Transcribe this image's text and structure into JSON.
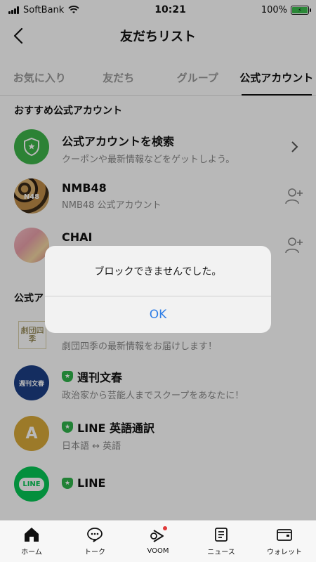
{
  "status": {
    "carrier": "SoftBank",
    "time": "10:21",
    "battery": "100%"
  },
  "nav": {
    "title": "友だちリスト"
  },
  "tabs": [
    {
      "label": "お気に入り"
    },
    {
      "label": "友だち"
    },
    {
      "label": "グループ"
    },
    {
      "label": "公式アカウント"
    }
  ],
  "sections": {
    "recommended": "おすすめ公式アカウント",
    "official": "公式ア"
  },
  "rows": [
    {
      "name": "公式アカウントを検索",
      "sub": "クーポンや最新情報などをゲットしよう。"
    },
    {
      "name": "NMB48",
      "sub": "NMB48 公式アカウント"
    },
    {
      "name": "CHAI",
      "sub": ""
    },
    {
      "name": "",
      "sub": "劇団四季の最新情報をお届けします！"
    },
    {
      "name": "週刊文春",
      "sub": "政治家から芸能人までスクープをあなたに！"
    },
    {
      "name": "LINE 英語通訳",
      "sub": "日本語 ↔ 英語"
    },
    {
      "name": "LINE",
      "sub": ""
    }
  ],
  "avatars": {
    "shiki": "劇団四季",
    "bunshun": "週刊文春",
    "eigo": "A",
    "line": "LINE"
  },
  "alert": {
    "message": "ブロックできませんでした。",
    "ok": "OK"
  },
  "tabbar": [
    {
      "label": "ホーム"
    },
    {
      "label": "トーク"
    },
    {
      "label": "VOOM"
    },
    {
      "label": "ニュース"
    },
    {
      "label": "ウォレット"
    }
  ],
  "colors": {
    "accent": "#2fb34a",
    "link": "#2f7ee6",
    "notify": "#e03a3a"
  }
}
